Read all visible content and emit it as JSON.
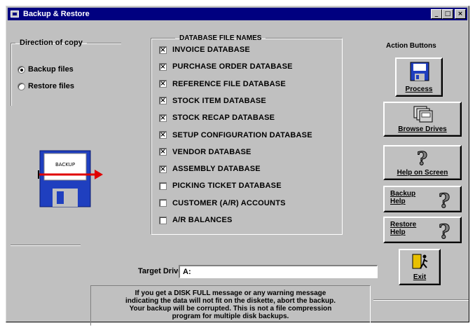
{
  "window": {
    "title": "Backup & Restore",
    "controls": {
      "minimize": "_",
      "maximize": "□",
      "close": "×"
    }
  },
  "direction": {
    "legend": "Direction of copy",
    "options": [
      {
        "label": "Backup files",
        "selected": true
      },
      {
        "label": "Restore files",
        "selected": false
      }
    ],
    "disk_label": "BACKUP"
  },
  "databases": {
    "legend": "DATABASE FILE NAMES",
    "items": [
      {
        "label": "INVOICE DATABASE",
        "checked": true
      },
      {
        "label": "PURCHASE ORDER DATABASE",
        "checked": true
      },
      {
        "label": "REFERENCE FILE DATABASE",
        "checked": true
      },
      {
        "label": "STOCK ITEM DATABASE",
        "checked": true
      },
      {
        "label": "STOCK RECAP DATABASE",
        "checked": true
      },
      {
        "label": "SETUP CONFIGURATION DATABASE",
        "checked": true
      },
      {
        "label": "VENDOR DATABASE",
        "checked": true
      },
      {
        "label": "ASSEMBLY DATABASE",
        "checked": true
      },
      {
        "label": "PICKING TICKET DATABASE",
        "checked": false
      },
      {
        "label": "CUSTOMER (A/R) ACCOUNTS",
        "checked": false
      },
      {
        "label": "A/R BALANCES",
        "checked": false
      }
    ]
  },
  "actions": {
    "legend": "Action Buttons",
    "process": "Process",
    "browse": "Browse Drives",
    "help_screen": "Help on Screen",
    "backup_help": "Backup Help",
    "restore_help": "Restore Help",
    "exit": "Exit"
  },
  "target": {
    "label": "Target Drive",
    "value": "A:"
  },
  "notice": {
    "lines": [
      "If you get a DISK FULL message or any warning message",
      "indicating the data will not fit on the diskette, abort the backup.",
      "Your backup will be corrupted. This is not a file compression",
      "program for multiple disk backups."
    ]
  },
  "colors": {
    "title_bar": "#000080",
    "face": "#c0c0c0",
    "disk_blue": "#1f3fbf",
    "arrow_red": "#e00000"
  }
}
